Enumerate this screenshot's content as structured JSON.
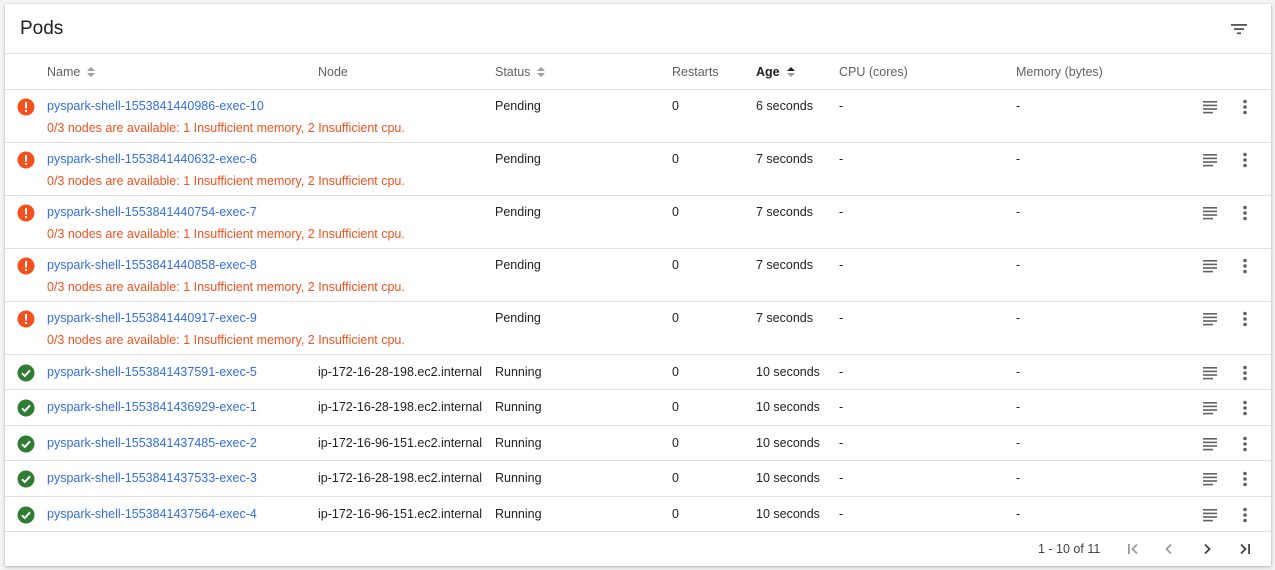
{
  "header": {
    "title": "Pods",
    "filter_icon": "filter-icon"
  },
  "columns": {
    "name": "Name",
    "node": "Node",
    "status": "Status",
    "restarts": "Restarts",
    "age": "Age",
    "cpu": "CPU (cores)",
    "memory": "Memory (bytes)"
  },
  "colors": {
    "link": "#326de6",
    "error": "#f4511e",
    "success": "#2e7d32"
  },
  "pods": [
    {
      "name": "pyspark-shell-1553841440986-exec-10",
      "node": "",
      "status": "Pending",
      "restarts": "0",
      "age": "6 seconds",
      "cpu": "-",
      "memory": "-",
      "state": "error",
      "message": "0/3 nodes are available: 1 Insufficient memory, 2 Insufficient cpu."
    },
    {
      "name": "pyspark-shell-1553841440632-exec-6",
      "node": "",
      "status": "Pending",
      "restarts": "0",
      "age": "7 seconds",
      "cpu": "-",
      "memory": "-",
      "state": "error",
      "message": "0/3 nodes are available: 1 Insufficient memory, 2 Insufficient cpu."
    },
    {
      "name": "pyspark-shell-1553841440754-exec-7",
      "node": "",
      "status": "Pending",
      "restarts": "0",
      "age": "7 seconds",
      "cpu": "-",
      "memory": "-",
      "state": "error",
      "message": "0/3 nodes are available: 1 Insufficient memory, 2 Insufficient cpu."
    },
    {
      "name": "pyspark-shell-1553841440858-exec-8",
      "node": "",
      "status": "Pending",
      "restarts": "0",
      "age": "7 seconds",
      "cpu": "-",
      "memory": "-",
      "state": "error",
      "message": "0/3 nodes are available: 1 Insufficient memory, 2 Insufficient cpu."
    },
    {
      "name": "pyspark-shell-1553841440917-exec-9",
      "node": "",
      "status": "Pending",
      "restarts": "0",
      "age": "7 seconds",
      "cpu": "-",
      "memory": "-",
      "state": "error",
      "message": "0/3 nodes are available: 1 Insufficient memory, 2 Insufficient cpu."
    },
    {
      "name": "pyspark-shell-1553841437591-exec-5",
      "node": "ip-172-16-28-198.ec2.internal",
      "status": "Running",
      "restarts": "0",
      "age": "10 seconds",
      "cpu": "-",
      "memory": "-",
      "state": "ok",
      "message": ""
    },
    {
      "name": "pyspark-shell-1553841436929-exec-1",
      "node": "ip-172-16-28-198.ec2.internal",
      "status": "Running",
      "restarts": "0",
      "age": "10 seconds",
      "cpu": "-",
      "memory": "-",
      "state": "ok",
      "message": ""
    },
    {
      "name": "pyspark-shell-1553841437485-exec-2",
      "node": "ip-172-16-96-151.ec2.internal",
      "status": "Running",
      "restarts": "0",
      "age": "10 seconds",
      "cpu": "-",
      "memory": "-",
      "state": "ok",
      "message": ""
    },
    {
      "name": "pyspark-shell-1553841437533-exec-3",
      "node": "ip-172-16-28-198.ec2.internal",
      "status": "Running",
      "restarts": "0",
      "age": "10 seconds",
      "cpu": "-",
      "memory": "-",
      "state": "ok",
      "message": ""
    },
    {
      "name": "pyspark-shell-1553841437564-exec-4",
      "node": "ip-172-16-96-151.ec2.internal",
      "status": "Running",
      "restarts": "0",
      "age": "10 seconds",
      "cpu": "-",
      "memory": "-",
      "state": "ok",
      "message": ""
    }
  ],
  "pagination": {
    "range": "1 - 10 of 11"
  }
}
